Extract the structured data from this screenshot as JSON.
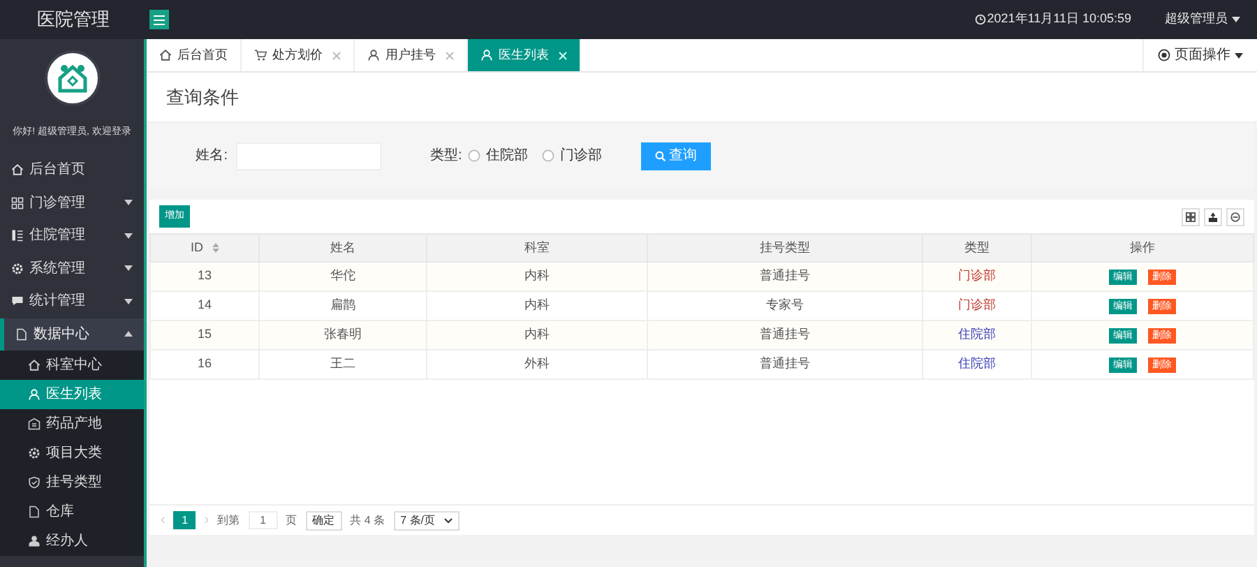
{
  "app_title": "医院管理",
  "header": {
    "datetime": "2021年11月11日 10:05:59",
    "user": "超级管理员"
  },
  "sidebar": {
    "welcome": "你好! 超级管理员, 欢迎登录",
    "items": [
      {
        "label": "后台首页",
        "kind": "link",
        "expanded": false,
        "selected": false
      },
      {
        "label": "门诊管理",
        "kind": "group",
        "expanded": false,
        "selected": false
      },
      {
        "label": "住院管理",
        "kind": "group",
        "expanded": false,
        "selected": false
      },
      {
        "label": "系统管理",
        "kind": "group",
        "expanded": false,
        "selected": false
      },
      {
        "label": "统计管理",
        "kind": "group",
        "expanded": false,
        "selected": false
      },
      {
        "label": "数据中心",
        "kind": "group",
        "expanded": true,
        "selected": false,
        "children": [
          {
            "label": "科室中心",
            "selected": false
          },
          {
            "label": "医生列表",
            "selected": true
          },
          {
            "label": "药品产地",
            "selected": false
          },
          {
            "label": "项目大类",
            "selected": false
          },
          {
            "label": "挂号类型",
            "selected": false
          },
          {
            "label": "仓库",
            "selected": false
          },
          {
            "label": "经办人",
            "selected": false
          }
        ]
      }
    ]
  },
  "tabs": [
    {
      "label": "后台首页",
      "closable": false,
      "selected": false
    },
    {
      "label": "处方划价",
      "closable": true,
      "selected": false
    },
    {
      "label": "用户挂号",
      "closable": true,
      "selected": false
    },
    {
      "label": "医生列表",
      "closable": true,
      "selected": true
    }
  ],
  "page_ops": "页面操作",
  "query": {
    "title": "查询条件",
    "name_label": "姓名:",
    "type_label": "类型:",
    "type_options": [
      {
        "label": "住院部",
        "selected": false
      },
      {
        "label": "门诊部",
        "selected": false
      }
    ],
    "search_button": "查询"
  },
  "add_button": "增加",
  "table": {
    "columns": [
      "ID",
      "姓名",
      "科室",
      "挂号类型",
      "类型",
      "操作"
    ],
    "rows": [
      {
        "id": "13",
        "name": "华佗",
        "dept": "内科",
        "reg_type": "普通挂号",
        "type": "门诊部",
        "kind": "outpatient",
        "edit": "编辑",
        "delete": "删除"
      },
      {
        "id": "14",
        "name": "扁鹊",
        "dept": "内科",
        "reg_type": "专家号",
        "type": "门诊部",
        "kind": "outpatient",
        "edit": "编辑",
        "delete": "删除"
      },
      {
        "id": "15",
        "name": "张春明",
        "dept": "内科",
        "reg_type": "普通挂号",
        "type": "住院部",
        "kind": "inpatient",
        "edit": "编辑",
        "delete": "删除"
      },
      {
        "id": "16",
        "name": "王二",
        "dept": "外科",
        "reg_type": "普通挂号",
        "type": "住院部",
        "kind": "inpatient",
        "edit": "编辑",
        "delete": "删除"
      }
    ]
  },
  "pagination": {
    "prev": "‹",
    "current": "1",
    "next": "›",
    "goto_label": "到第",
    "page_input": "1",
    "page_unit": "页",
    "confirm": "确定",
    "total": "共 4 条",
    "per_page": "7 条/页"
  }
}
